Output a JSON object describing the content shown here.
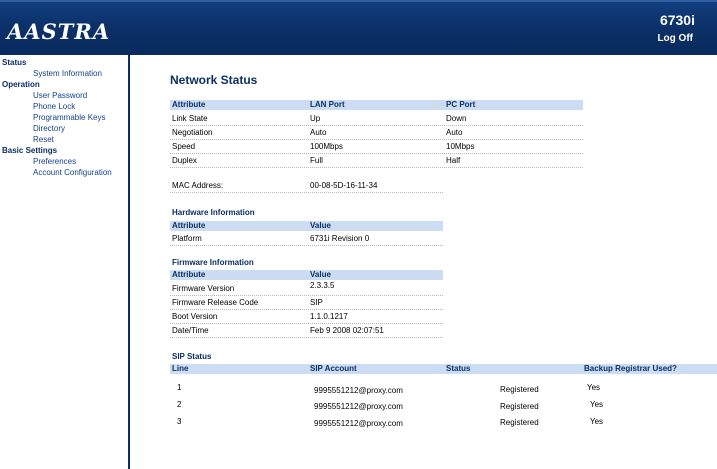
{
  "header": {
    "logo_text": "AASTRA",
    "model": "6730i",
    "logoff_label": "Log Off"
  },
  "sidebar": {
    "status_label": "Status",
    "status_items": [
      "System Information"
    ],
    "operation_label": "Operation",
    "operation_items": [
      "User Password",
      "Phone Lock",
      "Programmable Keys",
      "Directory",
      "Reset"
    ],
    "basic_label": "Basic Settings",
    "basic_items": [
      "Preferences",
      "Account Configuration"
    ]
  },
  "main": {
    "title": "Network Status",
    "network": {
      "headers": [
        "Attribute",
        "LAN Port",
        "PC Port"
      ],
      "rows": [
        [
          "Link State",
          "Up",
          "Down"
        ],
        [
          "Negotiation",
          "Auto",
          "Auto"
        ],
        [
          "Speed",
          "100Mbps",
          "10Mbps"
        ],
        [
          "Duplex",
          "Full",
          "Half"
        ]
      ],
      "mac_label": "MAC Address:",
      "mac_value": "00-08-5D-16-11-34"
    },
    "hardware": {
      "title": "Hardware Information",
      "headers": [
        "Attribute",
        "Value"
      ],
      "rows": [
        [
          "Platform",
          "6731i Revision 0"
        ]
      ]
    },
    "firmware": {
      "title": "Firmware Information",
      "headers": [
        "Attribute",
        "Value"
      ],
      "rows": [
        [
          "Firmware Version",
          "2.3.3.5"
        ],
        [
          "Firmware Release Code",
          "SIP"
        ],
        [
          "Boot Version",
          "1.1.0.1217"
        ],
        [
          "Date/Time",
          "Feb 9 2008 02:07:51"
        ]
      ]
    },
    "sip": {
      "title": "SIP Status",
      "headers": [
        "Line",
        "SIP Account",
        "Status",
        "Backup Registrar Used?"
      ],
      "rows": [
        [
          "1",
          "9995551212@proxy.com",
          "Registered",
          "Yes"
        ],
        [
          "2",
          "9995551212@proxy.com",
          "Registered",
          "Yes"
        ],
        [
          "3",
          "9995551212@proxy.com",
          "Registered",
          "Yes"
        ]
      ]
    }
  }
}
